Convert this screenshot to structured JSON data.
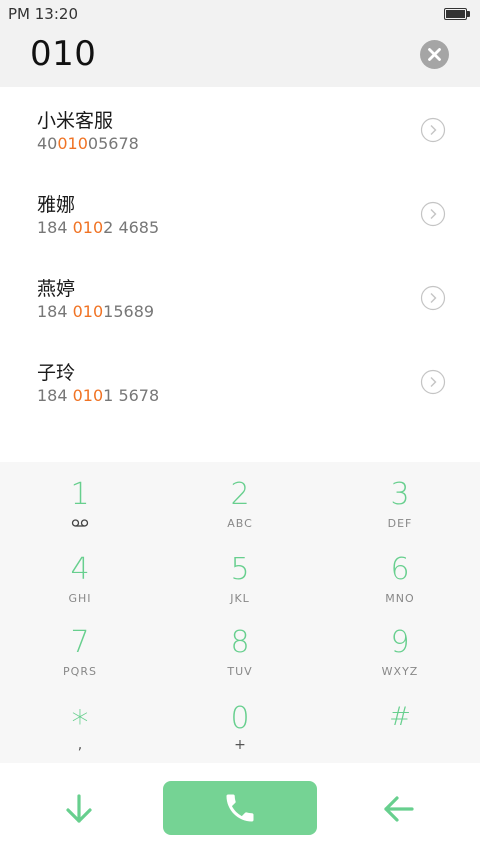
{
  "status_bar": {
    "time": "PM 13:20",
    "battery_icon": "battery-full-icon"
  },
  "input": {
    "value": "010",
    "clear_icon": "clear-circle-icon"
  },
  "results": [
    {
      "name": "小米客服",
      "number_pre": "40",
      "number_match": "010",
      "number_post": "05678"
    },
    {
      "name": "雅娜",
      "number_pre": "184 ",
      "number_match": "010",
      "number_post": "2 4685"
    },
    {
      "name": "燕婷",
      "number_pre": "184 ",
      "number_match": "010",
      "number_post": "15689"
    },
    {
      "name": "子玲",
      "number_pre": "184 ",
      "number_match": "010",
      "number_post": "1 5678"
    }
  ],
  "keypad": {
    "k1": {
      "digit": "1",
      "icon": "voicemail-icon"
    },
    "k2": {
      "digit": "2",
      "letters": "ABC"
    },
    "k3": {
      "digit": "3",
      "letters": "DEF"
    },
    "k4": {
      "digit": "4",
      "letters": "GHI"
    },
    "k5": {
      "digit": "5",
      "letters": "JKL"
    },
    "k6": {
      "digit": "6",
      "letters": "MNO"
    },
    "k7": {
      "digit": "7",
      "letters": "PQRS"
    },
    "k8": {
      "digit": "8",
      "letters": "TUV"
    },
    "k9": {
      "digit": "9",
      "letters": "WXYZ"
    },
    "kstar": {
      "digit": "*",
      "sub": ","
    },
    "k0": {
      "digit": "0",
      "sub": "+"
    },
    "khash": {
      "digit": "#"
    }
  },
  "actions": {
    "hide_keypad_icon": "arrow-down-icon",
    "call_icon": "phone-icon",
    "backspace_icon": "arrow-left-icon"
  },
  "colors": {
    "accent_green": "#67cf8e",
    "call_button": "#75d394",
    "match_highlight": "#f07324"
  }
}
